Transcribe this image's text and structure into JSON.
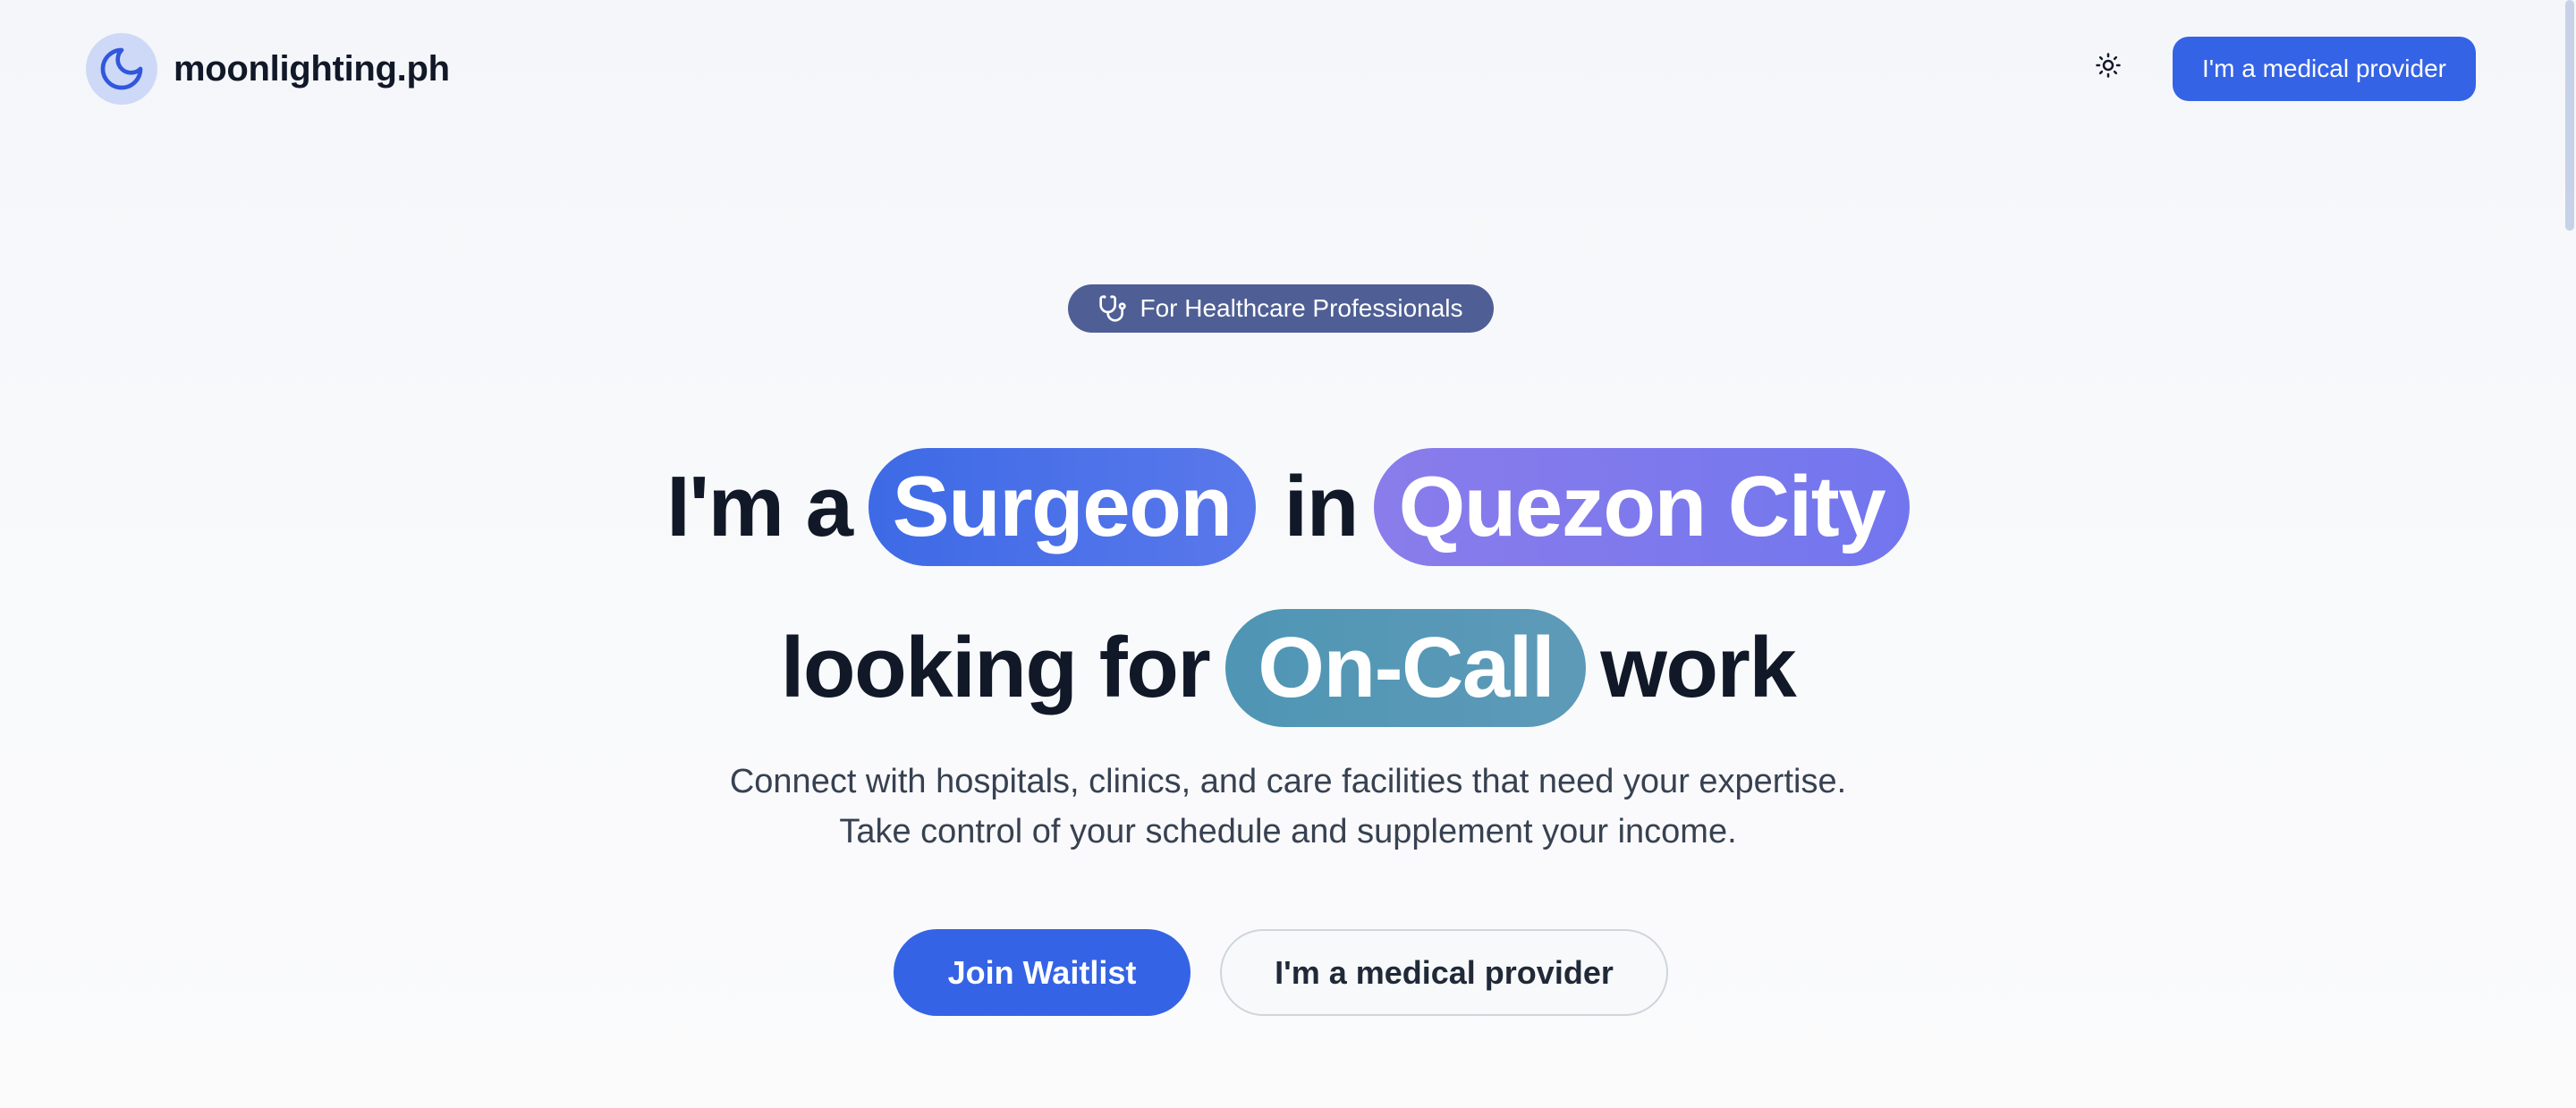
{
  "brand": {
    "name": "moonlighting.ph"
  },
  "header": {
    "cta_label": "I'm a medical provider"
  },
  "hero": {
    "eyebrow": "For Healthcare Professionals",
    "headline": {
      "prefix": "I'm a",
      "role": "Surgeon",
      "connector": "in",
      "city": "Quezon City",
      "lead": "looking for",
      "work_type": "On-Call",
      "suffix": "work"
    },
    "subtitle": {
      "line1": "Connect with hospitals, clinics, and care facilities that need your expertise.",
      "line2": "Take control of your schedule and supplement your income."
    },
    "primary_button": "Join Waitlist",
    "secondary_button": "I'm a medical provider"
  },
  "colors": {
    "accent": "#3563e5",
    "eyebrow_bg": "#4f5f95",
    "role_pill": "#4a70e8",
    "city_pill": "#7d7aec",
    "work_type_pill": "#5697b6"
  },
  "icons": {
    "logo": "crescent-moon-icon",
    "theme_toggle": "sun-icon",
    "eyebrow": "stethoscope-icon"
  }
}
